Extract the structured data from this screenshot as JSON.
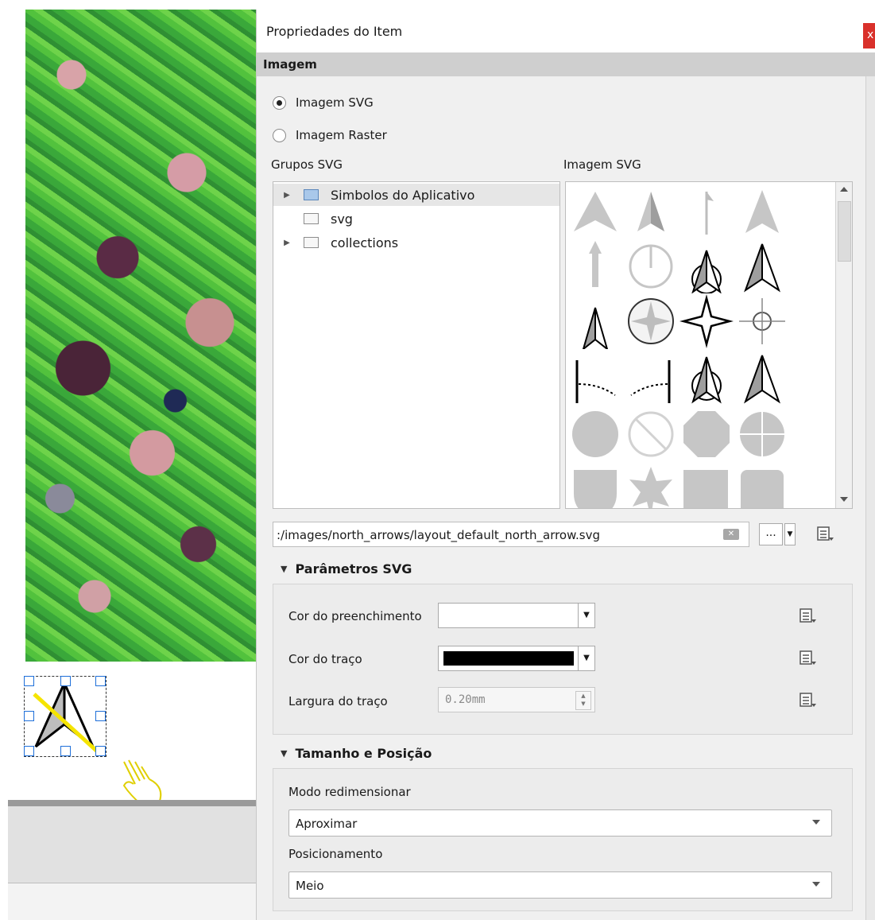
{
  "dialog": {
    "title": "Propriedades do Item",
    "close_label": "x",
    "section": "Imagem"
  },
  "image_type": {
    "svg_label": "Imagem SVG",
    "raster_label": "Imagem Raster",
    "selected": "svg"
  },
  "svg_groups": {
    "label": "Grupos SVG",
    "items": [
      {
        "label": "Simbolos do Aplicativo",
        "expandable": true,
        "selected": true
      },
      {
        "label": "svg",
        "expandable": false,
        "selected": false
      },
      {
        "label": "collections",
        "expandable": true,
        "selected": false
      }
    ]
  },
  "svg_images": {
    "label": "Imagem SVG"
  },
  "path": {
    "value": ":/images/north_arrows/layout_default_north_arrow.svg",
    "browse_label": "..."
  },
  "svg_params": {
    "title": "Parâmetros SVG",
    "fill_label": "Cor do preenchimento",
    "fill_color": "#ffffff",
    "stroke_label": "Cor do traço",
    "stroke_color": "#000000",
    "width_label": "Largura do traço",
    "width_value": "0.20mm"
  },
  "size_pos": {
    "title": "Tamanho e Posição",
    "resize_label": "Modo redimensionar",
    "resize_value": "Aproximar",
    "position_label": "Posicionamento",
    "position_value": "Meio"
  }
}
